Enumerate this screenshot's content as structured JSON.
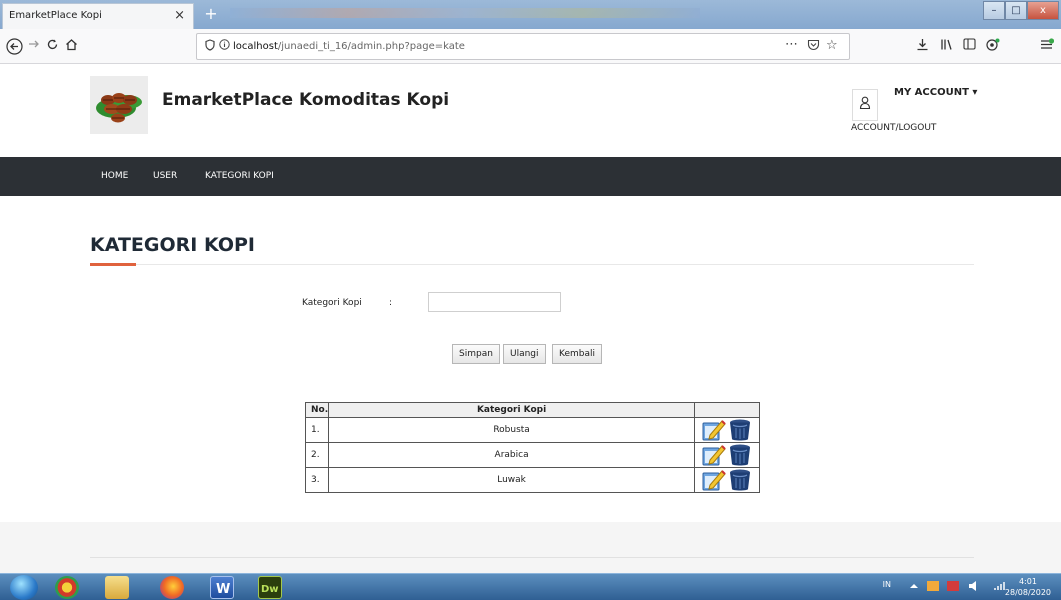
{
  "browser": {
    "tab_title": "EmarketPlace Kopi",
    "tab_close": "×",
    "new_tab": "+",
    "url_prefix": "localhost",
    "url_path": "/junaedi_ti_16/admin.php?page=kate",
    "window_buttons": {
      "minimize": "–",
      "maximize": "□",
      "close": "x"
    }
  },
  "header": {
    "brand": "EmarketPlace Komoditas Kopi",
    "account_label": "MY ACCOUNT ▾",
    "account_sub": "ACCOUNT/LOGOUT"
  },
  "menu": {
    "items": [
      {
        "label": "HOME"
      },
      {
        "label": "USER"
      },
      {
        "label": "KATEGORI KOPI"
      }
    ]
  },
  "section": {
    "title": "KATEGORI KOPI"
  },
  "form": {
    "label": "Kategori Kopi",
    "colon": ":",
    "value": "",
    "buttons": {
      "save": "Simpan",
      "reset": "Ulangi",
      "back": "Kembali"
    }
  },
  "table": {
    "headers": {
      "no": "No.",
      "category": "Kategori Kopi",
      "action": ""
    },
    "rows": [
      {
        "no": "1.",
        "category": "Robusta"
      },
      {
        "no": "2.",
        "category": "Arabica"
      },
      {
        "no": "3.",
        "category": "Luwak"
      }
    ]
  },
  "taskbar": {
    "tray_lang": "IN",
    "time": "4:01",
    "date": "28/08/2020"
  },
  "colors": {
    "menubar": "#2c3035",
    "accent": "#e0623d",
    "taskbar": "#2f5f93"
  }
}
